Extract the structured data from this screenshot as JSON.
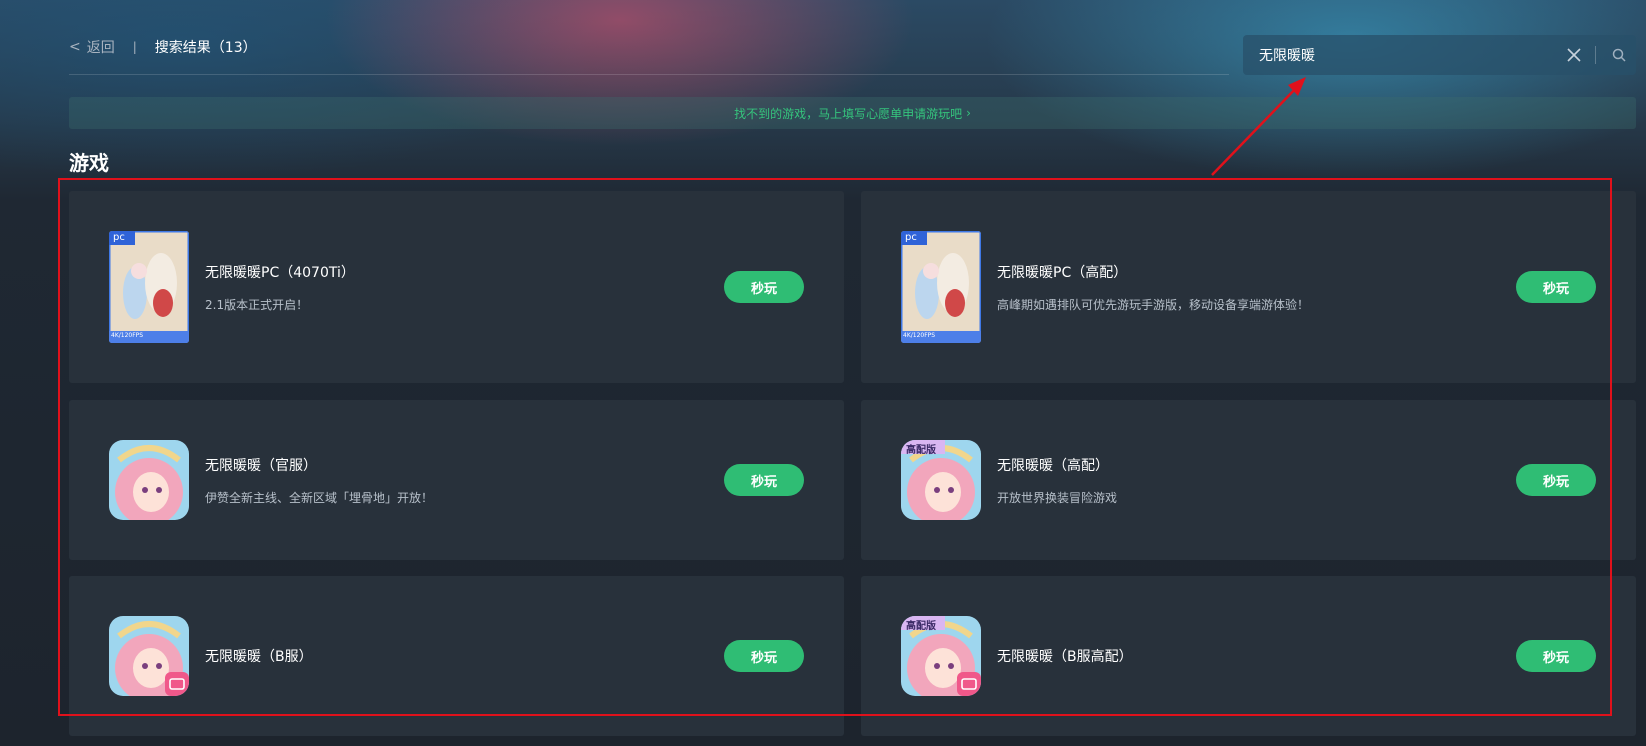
{
  "nav": {
    "back_chevron": "<",
    "back_label": "返回",
    "separator": "|",
    "result_title": "搜索结果（13）"
  },
  "search": {
    "value": "无限暖暖",
    "clear_icon": "close-icon",
    "search_icon": "search-icon"
  },
  "wish_bar": {
    "text": "找不到的游戏，马上填写心愿单申请游玩吧",
    "chevron": "›"
  },
  "section": {
    "title": "游戏"
  },
  "games": [
    {
      "name": "无限暖暖PC（4070Ti）",
      "desc": "2.1版本正式开启！",
      "button": "秒玩",
      "badge": "PC",
      "thumb_footer": "4K/120FPS"
    },
    {
      "name": "无限暖暖PC（高配）",
      "desc": "高峰期如遇排队可优先游玩手游版，移动设备享端游体验！",
      "button": "秒玩",
      "badge": "PC",
      "thumb_footer": "4K/120FPS"
    },
    {
      "name": "无限暖暖（官服）",
      "desc": "伊赞全新主线、全新区域「埋骨地」开放！",
      "button": "秒玩"
    },
    {
      "name": "无限暖暖（高配）",
      "desc": "开放世界换装冒险游戏",
      "button": "秒玩",
      "badge": "高配版"
    },
    {
      "name": "无限暖暖（B服）",
      "desc": "",
      "button": "秒玩"
    },
    {
      "name": "无限暖暖（B服高配）",
      "desc": "",
      "button": "秒玩",
      "badge": "高配版"
    }
  ],
  "colors": {
    "accent_green": "#2fbd74",
    "annotation_red": "#e0111b"
  }
}
